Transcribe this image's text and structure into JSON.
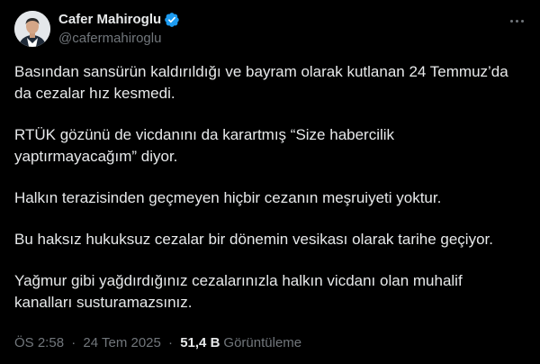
{
  "author": {
    "display_name": "Cafer Mahiroglu",
    "handle": "@cafermahiroglu",
    "verified": true,
    "verified_color": "#1d9bf0"
  },
  "more_icon": "more-horizontal-icon",
  "paragraphs": [
    {
      "lines": [
        "Basından sansürün kaldırıldığı ve bayram olarak kutlanan 24 Temmuz’da",
        "da cezalar hız kesmedi."
      ]
    },
    {
      "lines": [
        "RTÜK gözünü de vicdanını da karartmış “Size habercilik",
        "yaptırmayacağım” diyor."
      ]
    },
    {
      "lines": [
        "Halkın terazisinden geçmeyen hiçbir cezanın meşruiyeti yoktur."
      ]
    },
    {
      "lines": [
        "Bu haksız hukuksuz cezalar bir dönemin vesikası olarak tarihe geçiyor."
      ]
    },
    {
      "lines": [
        "Yağmur gibi yağdırdığınız cezalarınızla halkın vicdanı olan muhalif",
        "kanalları susturamazsınız."
      ]
    }
  ],
  "meta": {
    "time": "ÖS 2:58",
    "separator": "·",
    "date": "24 Tem 2025",
    "views_count": "51,4 B",
    "views_label": "Görüntüleme"
  },
  "colors": {
    "background": "#000000",
    "text": "#e7e9ea",
    "secondary": "#71767b",
    "accent": "#1d9bf0"
  }
}
